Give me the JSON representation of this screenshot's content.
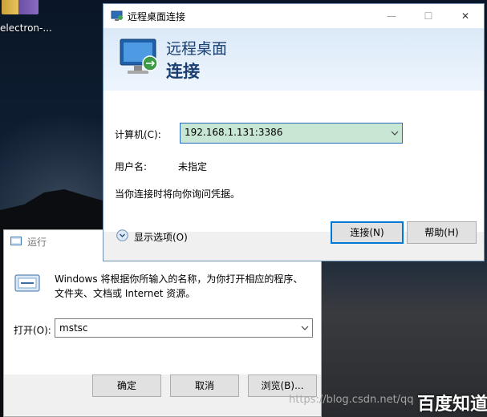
{
  "desktop": {
    "icon_label": "electron-..."
  },
  "run_dialog": {
    "title": "运行",
    "description_line1": "Windows 将根据你所输入的名称，为你打开相应的程序、",
    "description_line2": "文件夹、文档或 Internet 资源。",
    "open_label": "打开(O):",
    "open_value": "mstsc",
    "ok_label": "确定",
    "cancel_label": "取消",
    "browse_label": "浏览(B)..."
  },
  "rdp_dialog": {
    "title": "远程桌面连接",
    "banner_line1": "远程桌面",
    "banner_line2": "连接",
    "computer_label": "计算机(C):",
    "computer_value": "192.168.1.131:3386",
    "username_label": "用户名:",
    "username_value": "未指定",
    "note": "当你连接时将向你询问凭据。",
    "show_options": "显示选项(O)",
    "connect_label": "连接(N)",
    "help_label": "帮助(H)",
    "controls": {
      "minimize": "—",
      "maximize": "☐",
      "close": "✕"
    }
  },
  "overlay": {
    "watermark": "https://blog.csdn.net/qq",
    "brand": "百度知道"
  }
}
